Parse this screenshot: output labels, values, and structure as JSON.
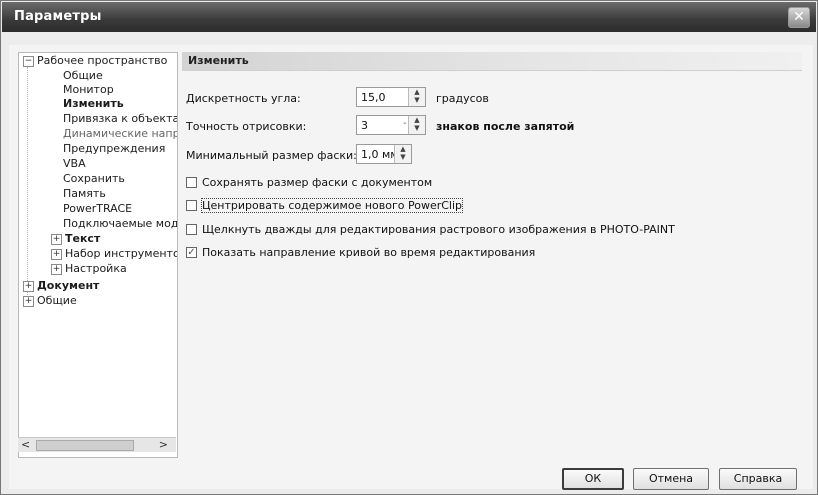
{
  "window": {
    "title": "Параметры",
    "close_glyph": "✕"
  },
  "tree": {
    "items": [
      {
        "label": "Рабочее пространство",
        "expander": "−"
      },
      {
        "label": "Общие"
      },
      {
        "label": "Монитор"
      },
      {
        "label": "Изменить"
      },
      {
        "label": "Привязка к объектам"
      },
      {
        "label": "Динамические направляющие"
      },
      {
        "label": "Предупреждения"
      },
      {
        "label": "VBA"
      },
      {
        "label": "Сохранить"
      },
      {
        "label": "Память"
      },
      {
        "label": "PowerTRACE"
      },
      {
        "label": "Подключаемые модули"
      },
      {
        "label": "Текст",
        "expander": "+"
      },
      {
        "label": "Набор инструментов",
        "expander": "+"
      },
      {
        "label": "Настройка",
        "expander": "+"
      },
      {
        "label": "Документ",
        "expander": "+"
      },
      {
        "label": "Общие",
        "expander": "+"
      }
    ],
    "scroll_left": "<",
    "scroll_right": ">"
  },
  "panel": {
    "header": "Изменить",
    "angle": {
      "label": "Дискретность угла:",
      "value": "15,0",
      "unit": "градусов"
    },
    "precision": {
      "label": "Точность отрисовки:",
      "value": "3",
      "sep": "-",
      "unit": "знаков после запятой"
    },
    "bevel": {
      "label": "Минимальный размер фаски:",
      "value": "1,0 мм"
    },
    "checkboxes": [
      {
        "label": "Сохранять размер фаски с документом",
        "checked": false
      },
      {
        "label": "Центрировать содержимое нового PowerClip",
        "checked": false
      },
      {
        "label": "Щелкнуть дважды для редактирования растрового изображения в PHOTO-PAINT",
        "checked": false
      },
      {
        "label": "Показать направление кривой во время редактирования",
        "checked": true
      }
    ]
  },
  "buttons": {
    "ok": "ОК",
    "cancel": "Отмена",
    "help": "Справка"
  }
}
